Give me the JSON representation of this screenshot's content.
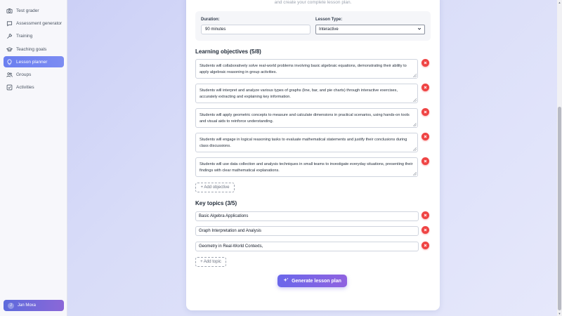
{
  "sidebar": {
    "items": [
      {
        "label": "Test grader",
        "icon": "camera-icon",
        "active": false
      },
      {
        "label": "Assessment generator",
        "icon": "chat-icon",
        "active": false
      },
      {
        "label": "Training",
        "icon": "wrench-icon",
        "active": false
      },
      {
        "label": "Teaching goals",
        "icon": "graduation-cap-icon",
        "active": false
      },
      {
        "label": "Lesson planner",
        "icon": "lightbulb-icon",
        "active": true
      },
      {
        "label": "Groups",
        "icon": "users-icon",
        "active": false
      },
      {
        "label": "Activities",
        "icon": "checkbox-icon",
        "active": false
      }
    ],
    "user": {
      "initial": "J",
      "name": "Jan Moxa"
    }
  },
  "header": {
    "subtitle": "and create your complete lesson plan."
  },
  "settings": {
    "duration_label": "Duration:",
    "duration_value": "90 minutes",
    "lesson_type_label": "Lesson Type:",
    "lesson_type_value": "Interactive"
  },
  "objectives": {
    "heading": "Learning objectives (5/8)",
    "items": [
      "Students will collaboratively solve real-world problems involving basic algebraic equations, demonstrating their ability to apply algebraic reasoning in group activities.",
      "Students will interpret and analyze various types of graphs (line, bar, and pie charts) through interactive exercises, accurately extracting and explaining key information.",
      "Students will apply geometric concepts to measure and calculate dimensions in practical scenarios, using hands-on tools and visual aids to reinforce understanding.",
      "Students will engage in logical reasoning tasks to evaluate mathematical statements and justify their conclusions during class discussions.",
      "Students will use data collection and analysis techniques in small teams to investigate everyday situations, presenting their findings with clear mathematical explanations."
    ],
    "add_label": "+ Add objective"
  },
  "topics": {
    "heading": "Key topics (3/5)",
    "items": [
      "Basic Algebra Applications",
      "Graph Interpretation and Analysis",
      "Geometry in Real-World Contexts,"
    ],
    "add_label": "+ Add topic"
  },
  "actions": {
    "generate_label": "Generate lesson plan"
  },
  "colors": {
    "accent": "#6b7ff0",
    "danger": "#ef4444",
    "primary_button": "#7a65e6"
  }
}
